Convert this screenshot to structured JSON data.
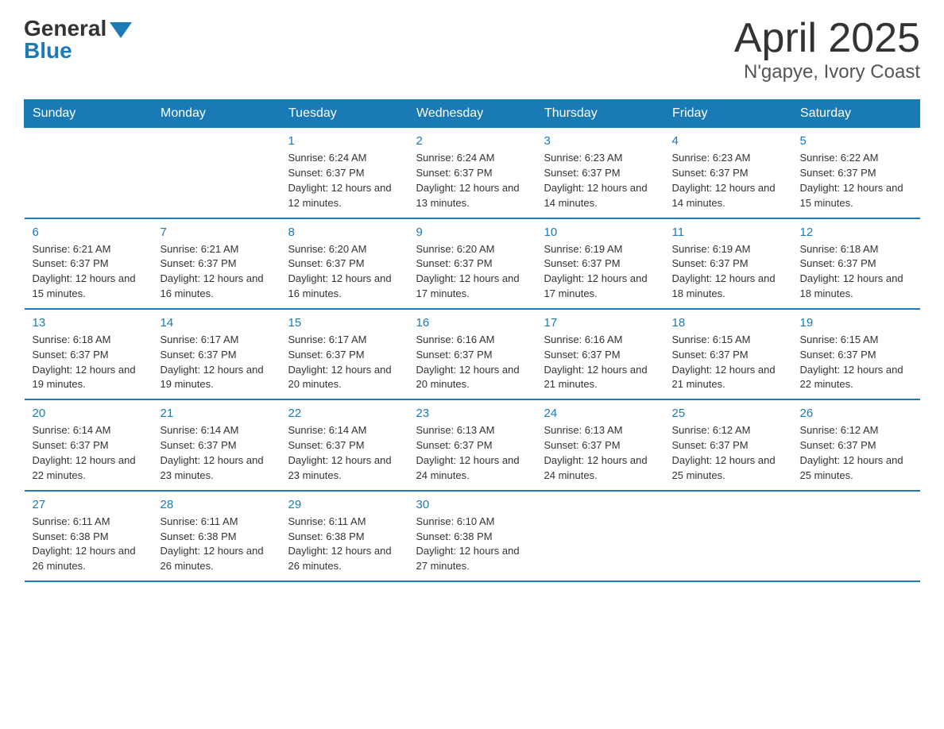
{
  "logo": {
    "general": "General",
    "blue": "Blue"
  },
  "title": "April 2025",
  "subtitle": "N'gapye, Ivory Coast",
  "weekdays": [
    "Sunday",
    "Monday",
    "Tuesday",
    "Wednesday",
    "Thursday",
    "Friday",
    "Saturday"
  ],
  "weeks": [
    [
      {
        "day": "",
        "sunrise": "",
        "sunset": "",
        "daylight": ""
      },
      {
        "day": "",
        "sunrise": "",
        "sunset": "",
        "daylight": ""
      },
      {
        "day": "1",
        "sunrise": "Sunrise: 6:24 AM",
        "sunset": "Sunset: 6:37 PM",
        "daylight": "Daylight: 12 hours and 12 minutes."
      },
      {
        "day": "2",
        "sunrise": "Sunrise: 6:24 AM",
        "sunset": "Sunset: 6:37 PM",
        "daylight": "Daylight: 12 hours and 13 minutes."
      },
      {
        "day": "3",
        "sunrise": "Sunrise: 6:23 AM",
        "sunset": "Sunset: 6:37 PM",
        "daylight": "Daylight: 12 hours and 14 minutes."
      },
      {
        "day": "4",
        "sunrise": "Sunrise: 6:23 AM",
        "sunset": "Sunset: 6:37 PM",
        "daylight": "Daylight: 12 hours and 14 minutes."
      },
      {
        "day": "5",
        "sunrise": "Sunrise: 6:22 AM",
        "sunset": "Sunset: 6:37 PM",
        "daylight": "Daylight: 12 hours and 15 minutes."
      }
    ],
    [
      {
        "day": "6",
        "sunrise": "Sunrise: 6:21 AM",
        "sunset": "Sunset: 6:37 PM",
        "daylight": "Daylight: 12 hours and 15 minutes."
      },
      {
        "day": "7",
        "sunrise": "Sunrise: 6:21 AM",
        "sunset": "Sunset: 6:37 PM",
        "daylight": "Daylight: 12 hours and 16 minutes."
      },
      {
        "day": "8",
        "sunrise": "Sunrise: 6:20 AM",
        "sunset": "Sunset: 6:37 PM",
        "daylight": "Daylight: 12 hours and 16 minutes."
      },
      {
        "day": "9",
        "sunrise": "Sunrise: 6:20 AM",
        "sunset": "Sunset: 6:37 PM",
        "daylight": "Daylight: 12 hours and 17 minutes."
      },
      {
        "day": "10",
        "sunrise": "Sunrise: 6:19 AM",
        "sunset": "Sunset: 6:37 PM",
        "daylight": "Daylight: 12 hours and 17 minutes."
      },
      {
        "day": "11",
        "sunrise": "Sunrise: 6:19 AM",
        "sunset": "Sunset: 6:37 PM",
        "daylight": "Daylight: 12 hours and 18 minutes."
      },
      {
        "day": "12",
        "sunrise": "Sunrise: 6:18 AM",
        "sunset": "Sunset: 6:37 PM",
        "daylight": "Daylight: 12 hours and 18 minutes."
      }
    ],
    [
      {
        "day": "13",
        "sunrise": "Sunrise: 6:18 AM",
        "sunset": "Sunset: 6:37 PM",
        "daylight": "Daylight: 12 hours and 19 minutes."
      },
      {
        "day": "14",
        "sunrise": "Sunrise: 6:17 AM",
        "sunset": "Sunset: 6:37 PM",
        "daylight": "Daylight: 12 hours and 19 minutes."
      },
      {
        "day": "15",
        "sunrise": "Sunrise: 6:17 AM",
        "sunset": "Sunset: 6:37 PM",
        "daylight": "Daylight: 12 hours and 20 minutes."
      },
      {
        "day": "16",
        "sunrise": "Sunrise: 6:16 AM",
        "sunset": "Sunset: 6:37 PM",
        "daylight": "Daylight: 12 hours and 20 minutes."
      },
      {
        "day": "17",
        "sunrise": "Sunrise: 6:16 AM",
        "sunset": "Sunset: 6:37 PM",
        "daylight": "Daylight: 12 hours and 21 minutes."
      },
      {
        "day": "18",
        "sunrise": "Sunrise: 6:15 AM",
        "sunset": "Sunset: 6:37 PM",
        "daylight": "Daylight: 12 hours and 21 minutes."
      },
      {
        "day": "19",
        "sunrise": "Sunrise: 6:15 AM",
        "sunset": "Sunset: 6:37 PM",
        "daylight": "Daylight: 12 hours and 22 minutes."
      }
    ],
    [
      {
        "day": "20",
        "sunrise": "Sunrise: 6:14 AM",
        "sunset": "Sunset: 6:37 PM",
        "daylight": "Daylight: 12 hours and 22 minutes."
      },
      {
        "day": "21",
        "sunrise": "Sunrise: 6:14 AM",
        "sunset": "Sunset: 6:37 PM",
        "daylight": "Daylight: 12 hours and 23 minutes."
      },
      {
        "day": "22",
        "sunrise": "Sunrise: 6:14 AM",
        "sunset": "Sunset: 6:37 PM",
        "daylight": "Daylight: 12 hours and 23 minutes."
      },
      {
        "day": "23",
        "sunrise": "Sunrise: 6:13 AM",
        "sunset": "Sunset: 6:37 PM",
        "daylight": "Daylight: 12 hours and 24 minutes."
      },
      {
        "day": "24",
        "sunrise": "Sunrise: 6:13 AM",
        "sunset": "Sunset: 6:37 PM",
        "daylight": "Daylight: 12 hours and 24 minutes."
      },
      {
        "day": "25",
        "sunrise": "Sunrise: 6:12 AM",
        "sunset": "Sunset: 6:37 PM",
        "daylight": "Daylight: 12 hours and 25 minutes."
      },
      {
        "day": "26",
        "sunrise": "Sunrise: 6:12 AM",
        "sunset": "Sunset: 6:37 PM",
        "daylight": "Daylight: 12 hours and 25 minutes."
      }
    ],
    [
      {
        "day": "27",
        "sunrise": "Sunrise: 6:11 AM",
        "sunset": "Sunset: 6:38 PM",
        "daylight": "Daylight: 12 hours and 26 minutes."
      },
      {
        "day": "28",
        "sunrise": "Sunrise: 6:11 AM",
        "sunset": "Sunset: 6:38 PM",
        "daylight": "Daylight: 12 hours and 26 minutes."
      },
      {
        "day": "29",
        "sunrise": "Sunrise: 6:11 AM",
        "sunset": "Sunset: 6:38 PM",
        "daylight": "Daylight: 12 hours and 26 minutes."
      },
      {
        "day": "30",
        "sunrise": "Sunrise: 6:10 AM",
        "sunset": "Sunset: 6:38 PM",
        "daylight": "Daylight: 12 hours and 27 minutes."
      },
      {
        "day": "",
        "sunrise": "",
        "sunset": "",
        "daylight": ""
      },
      {
        "day": "",
        "sunrise": "",
        "sunset": "",
        "daylight": ""
      },
      {
        "day": "",
        "sunrise": "",
        "sunset": "",
        "daylight": ""
      }
    ]
  ]
}
